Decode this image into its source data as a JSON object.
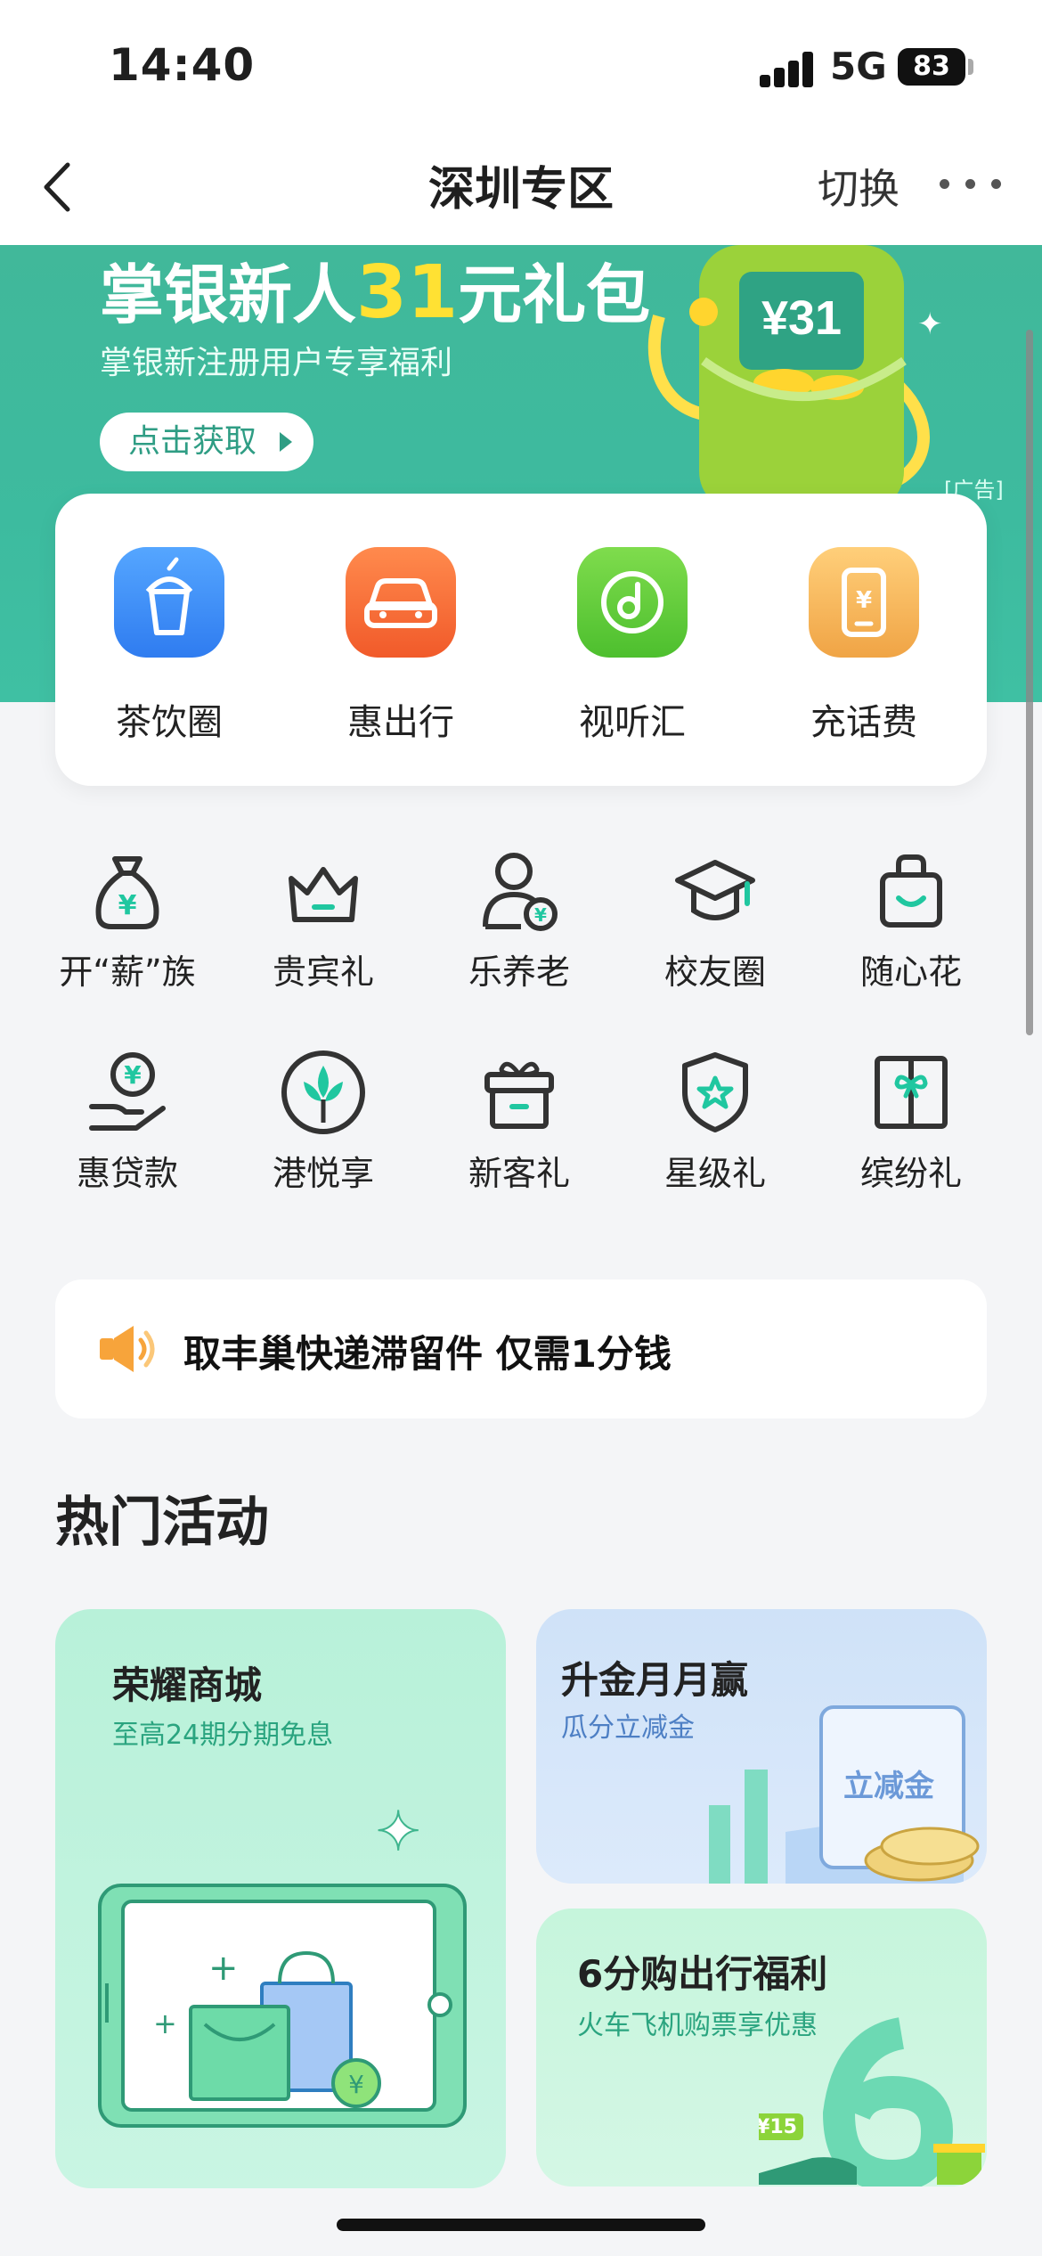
{
  "status_bar": {
    "time": "14:40",
    "network": "5G",
    "battery": "83"
  },
  "nav": {
    "title": "深圳专区",
    "switch_label": "切换"
  },
  "banner": {
    "title_prefix": "掌银新人",
    "title_highlight": "31",
    "title_suffix": "元礼包",
    "subtitle": "掌银新注册用户专享福利",
    "button_label": "点击获取",
    "ad_label": "[广告]",
    "envelope_amount": "¥31"
  },
  "quick_services": [
    {
      "label": "茶饮圈",
      "icon": "drink-cup-icon",
      "color": "#3b8cf5"
    },
    {
      "label": "惠出行",
      "icon": "car-icon",
      "color": "#f46a3b"
    },
    {
      "label": "视听汇",
      "icon": "music-disc-icon",
      "color": "#5cc93d"
    },
    {
      "label": "充话费",
      "icon": "phone-bill-icon",
      "color": "#f2a94a"
    }
  ],
  "grid_items": [
    {
      "label": "开“薪”族",
      "icon": "money-bag-icon"
    },
    {
      "label": "贵宾礼",
      "icon": "crown-icon"
    },
    {
      "label": "乐养老",
      "icon": "elder-user-icon"
    },
    {
      "label": "校友圈",
      "icon": "graduation-cap-icon"
    },
    {
      "label": "随心花",
      "icon": "shopping-bag-icon"
    },
    {
      "label": "惠贷款",
      "icon": "loan-hand-icon"
    },
    {
      "label": "港悦享",
      "icon": "bauhinia-icon"
    },
    {
      "label": "新客礼",
      "icon": "gift-box-icon"
    },
    {
      "label": "星级礼",
      "icon": "star-shield-icon"
    },
    {
      "label": "缤纷礼",
      "icon": "gift-card-icon"
    }
  ],
  "notice": {
    "text": "取丰巢快递滞留件 仅需1分钱",
    "icon": "speaker-icon"
  },
  "hot_section": {
    "title": "热门活动"
  },
  "activities": [
    {
      "title": "荣耀商城",
      "subtitle": "至高24期分期免息"
    },
    {
      "title": "升金月月赢",
      "subtitle": "瓜分立减金",
      "tag": "立减金"
    },
    {
      "title": "6分购出行福利",
      "subtitle": "火车飞机购票享优惠",
      "badge": "¥15"
    }
  ],
  "colors": {
    "accent": "#3fbc9f",
    "highlight": "#ffe133",
    "icon_accent": "#20c7a0"
  }
}
